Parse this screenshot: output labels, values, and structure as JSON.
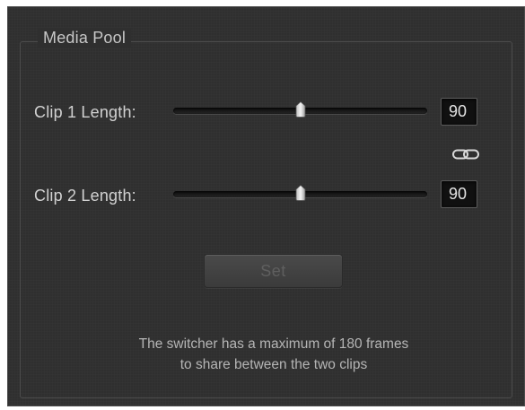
{
  "media_pool": {
    "title": "Media Pool",
    "clip1": {
      "label": "Clip 1 Length:",
      "value": "90",
      "slider_fraction": 0.5
    },
    "clip2": {
      "label": "Clip 2 Length:",
      "value": "90",
      "slider_fraction": 0.5
    },
    "link_icon": "chain-link-icon",
    "set_label": "Set",
    "set_enabled": false,
    "note_line1": "The switcher has a maximum of 180 frames",
    "note_line2": "to share between the two clips"
  },
  "colors": {
    "panel_background": "#2f2f2f",
    "text": "#d2d2d2",
    "field_background": "#101010",
    "disabled_text": "#5f5f5f"
  }
}
